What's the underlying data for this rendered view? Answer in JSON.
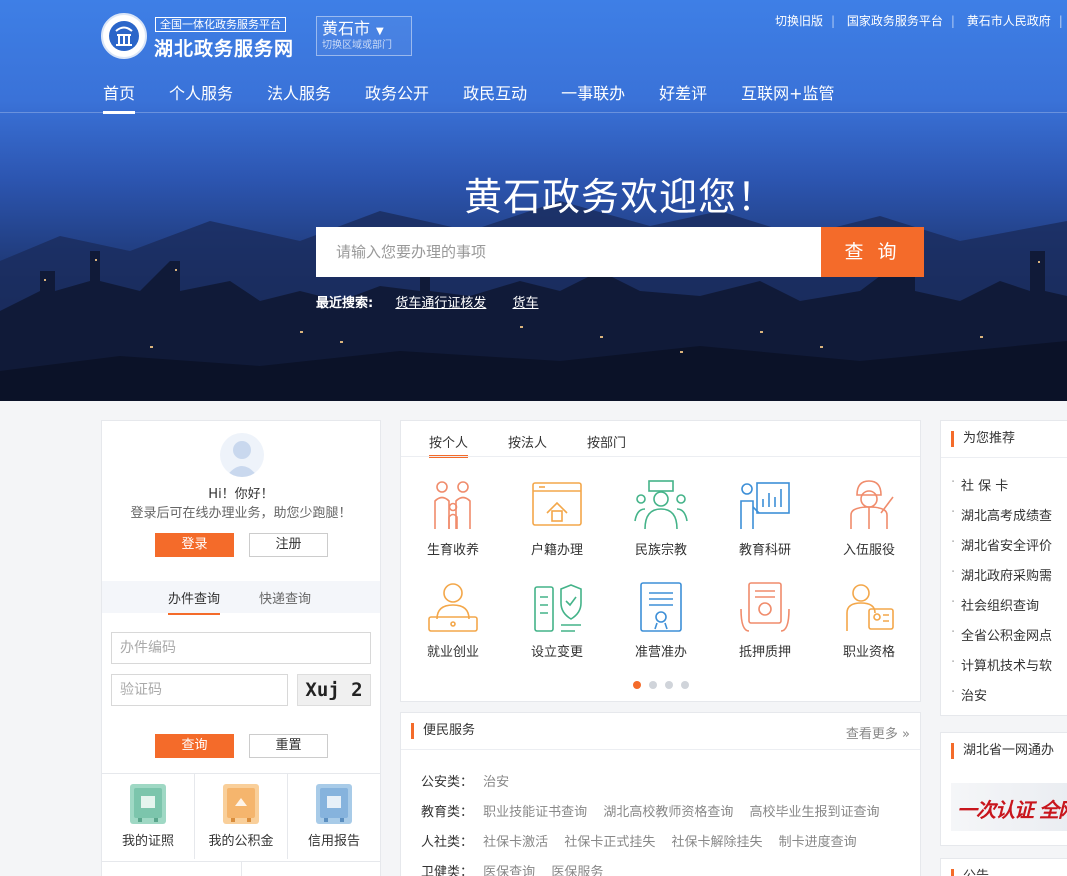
{
  "header": {
    "logo_subtitle": "全国一体化政务服务平台",
    "logo_title": "湖北政务服务网",
    "region": {
      "city": "黄石市",
      "hint": "切换区域或部门"
    },
    "top_links": [
      "切换旧版",
      "国家政务服务平台",
      "黄石市人民政府"
    ],
    "nav": [
      "首页",
      "个人服务",
      "法人服务",
      "政务公开",
      "政民互动",
      "一事联办",
      "好差评",
      "互联网+监管"
    ]
  },
  "hero": {
    "welcome": "黄石政务欢迎您！",
    "search_placeholder": "请输入您要办理的事项",
    "search_button": "查 询",
    "recent_label": "最近搜索:",
    "recent_terms": [
      "货车通行证核发",
      "货车"
    ]
  },
  "user_panel": {
    "greeting": "Hi！你好！",
    "tip": "登录后可在线办理业务，助您少跑腿！",
    "login": "登录",
    "register": "注册",
    "tabs": [
      "办件查询",
      "快递查询"
    ],
    "code_placeholder": "办件编码",
    "captcha_placeholder": "验证码",
    "captcha_text": "Xuj 2",
    "query": "查询",
    "reset": "重置",
    "services": [
      "我的证照",
      "我的公积金",
      "信用报告"
    ]
  },
  "categories": {
    "tabs": [
      "按个人",
      "按法人",
      "按部门"
    ],
    "items": [
      "生育收养",
      "户籍办理",
      "民族宗教",
      "教育科研",
      "入伍服役",
      "就业创业",
      "设立变更",
      "准营准办",
      "抵押质押",
      "职业资格"
    ]
  },
  "convenience": {
    "title": "便民服务",
    "more": "查看更多",
    "rows": [
      {
        "label": "公安类：",
        "items": [
          "治安"
        ]
      },
      {
        "label": "教育类：",
        "items": [
          "职业技能证书查询",
          "湖北高校教师资格查询",
          "高校毕业生报到证查询"
        ]
      },
      {
        "label": "人社类：",
        "items": [
          "社保卡激活",
          "社保卡正式挂失",
          "社保卡解除挂失",
          "制卡进度查询"
        ]
      },
      {
        "label": "卫健类：",
        "items": [
          "医保查询",
          "医保服务"
        ]
      }
    ]
  },
  "recommend": {
    "title": "为您推荐",
    "items": [
      "社 保 卡",
      "湖北高考成绩查",
      "湖北省安全评价",
      "湖北政府采购需",
      "社会组织查询",
      "全省公积金网点",
      "计算机技术与软",
      "治安"
    ]
  },
  "yiwangtong": {
    "title": "湖北省一网通办",
    "banner": "一次认证 全网"
  },
  "notice": {
    "title": "公告"
  },
  "colors": {
    "accent": "#f46b2a",
    "hero_top": "#3e7fe6",
    "hero_bottom": "#131f3f"
  }
}
